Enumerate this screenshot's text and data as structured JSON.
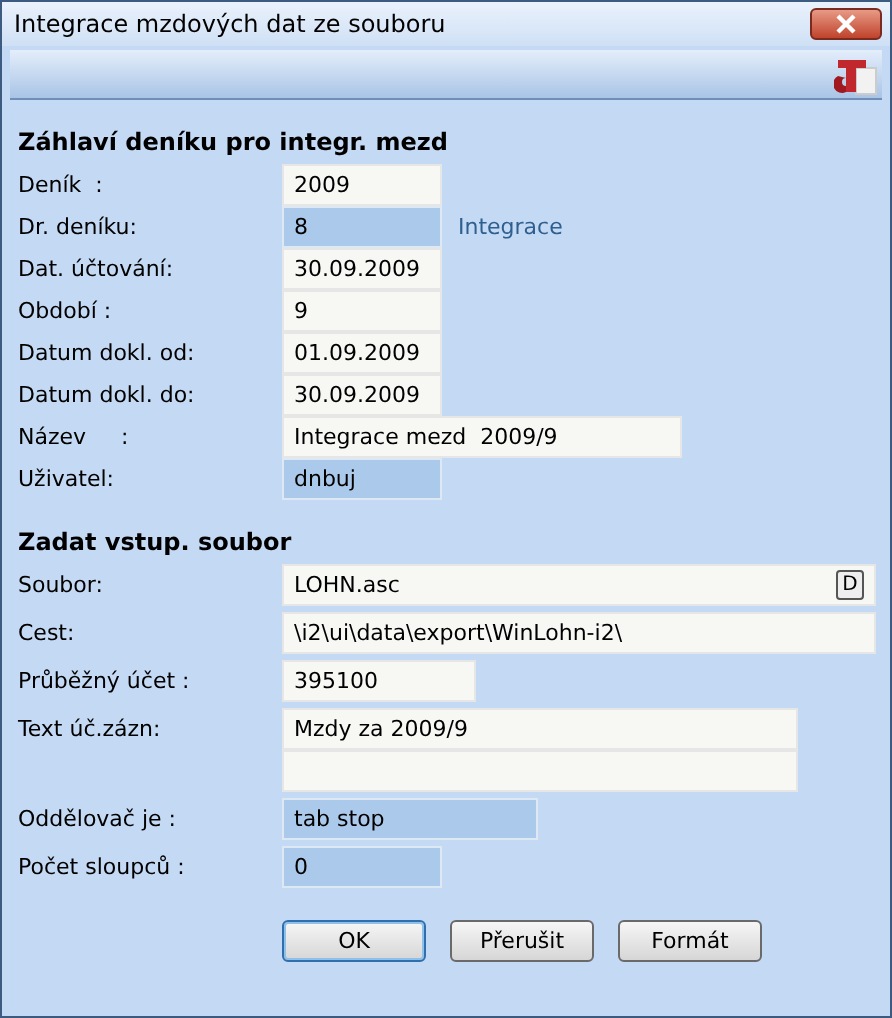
{
  "window": {
    "title": "Integrace mzdových dat ze souboru"
  },
  "sections": [
    {
      "heading": "Záhlaví deníku pro integr. mezd",
      "fields": [
        {
          "label": "Deník  :",
          "value": "2009",
          "kind": "short",
          "disabled": false
        },
        {
          "label": "Dr. deníku:",
          "value": "8",
          "kind": "short",
          "disabled": true,
          "note": "Integrace"
        },
        {
          "label": "Dat. účtování:",
          "value": "30.09.2009",
          "kind": "short",
          "disabled": false
        },
        {
          "label": "Období :",
          "value": "9",
          "kind": "short",
          "disabled": false
        },
        {
          "label": "Datum dokl. od:",
          "value": "01.09.2009",
          "kind": "short",
          "disabled": false
        },
        {
          "label": "Datum dokl. do:",
          "value": "30.09.2009",
          "kind": "short",
          "disabled": false
        },
        {
          "label": "Název     :",
          "value": "Integrace mezd  2009/9",
          "kind": "name",
          "disabled": false
        },
        {
          "label": "Uživatel:",
          "value": "dnbuj",
          "kind": "short",
          "disabled": true
        }
      ]
    },
    {
      "heading": "Zadat vstup. soubor",
      "fields": [
        {
          "label": "Soubor:",
          "value": "LOHN.asc",
          "kind": "path",
          "disabled": false,
          "button": "D"
        },
        {
          "label": "Cest:",
          "value": "\\i2\\ui\\data\\export\\WinLohn-i2\\",
          "kind": "path",
          "disabled": false
        },
        {
          "label": "Průběžný účet :",
          "value": "395100",
          "kind": "account",
          "disabled": false
        },
        {
          "label": "Text úč.zázn:",
          "value": "Mzdy za 2009/9",
          "kind": "text",
          "disabled": false,
          "second_line": true
        },
        {
          "label": "Oddělovač je :",
          "value": "tab stop",
          "kind": "choice",
          "disabled": true
        },
        {
          "label": "Počet sloupců :",
          "value": "0",
          "kind": "short",
          "disabled": true
        }
      ]
    }
  ],
  "buttons": [
    {
      "label": "OK",
      "selected": true
    },
    {
      "label": "Přerušit",
      "selected": false
    },
    {
      "label": "Formát",
      "selected": false
    }
  ]
}
